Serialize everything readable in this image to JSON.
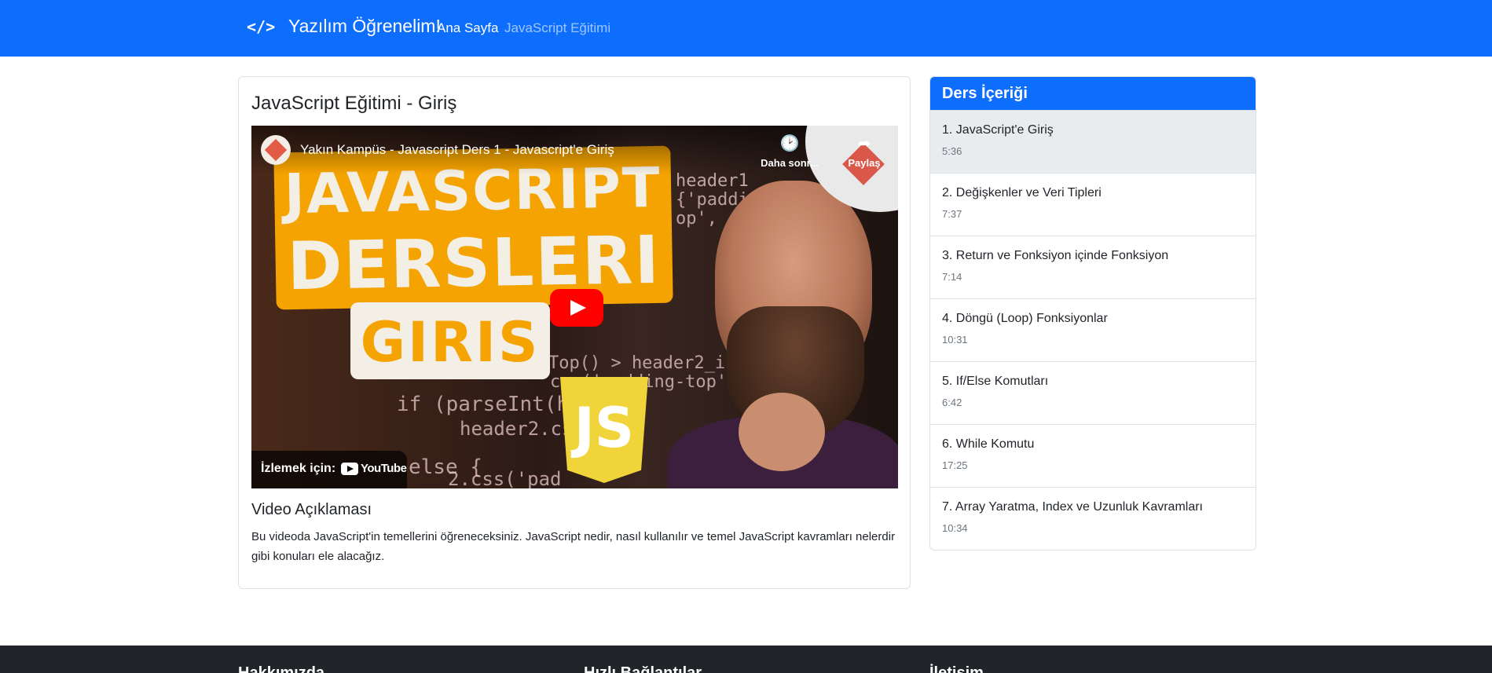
{
  "nav": {
    "brand_icon": "</>",
    "brand": "Yazılım Öğrenelim!",
    "links": [
      "Ana Sayfa",
      "JavaScript Eğitimi"
    ]
  },
  "main": {
    "title": "JavaScript Eğitimi - Giriş",
    "video": {
      "title": "Yakın Kampüs - Javascript Ders 1 - Javascript'e Giriş",
      "watch_later": "Daha sonr...",
      "share": "Paylaş",
      "watch_on": "İzlemek için:",
      "youtube": "YouTube",
      "thumb": {
        "line1": "JAVASCRIPT",
        "line2": "DERSLERI",
        "line3": "GIRIS",
        "js": "JS",
        "code": [
          "header1",
          "{'paddi",
          "op',",
          "rollTop() > header2_initia",
          "css('padding-top'",
          "if (parseInt(h",
          "header2.css",
          "else {",
          "2.css('pad"
        ]
      }
    },
    "description_title": "Video Açıklaması",
    "description": "Bu videoda JavaScript'in temellerini öğreneceksiniz. JavaScript nedir, nasıl kullanılır ve temel JavaScript kavramları nelerdir gibi konuları ele alacağız."
  },
  "sidebar": {
    "title": "Ders İçeriği",
    "lessons": [
      {
        "title": "1. JavaScript'e Giriş",
        "duration": "5:36",
        "active": true
      },
      {
        "title": "2. Değişkenler ve Veri Tipleri",
        "duration": "7:37"
      },
      {
        "title": "3. Return ve Fonksiyon içinde Fonksiyon",
        "duration": "7:14"
      },
      {
        "title": "4. Döngü (Loop) Fonksiyonlar",
        "duration": "10:31"
      },
      {
        "title": "5. If/Else Komutları",
        "duration": "6:42"
      },
      {
        "title": "6. While Komutu",
        "duration": "17:25"
      },
      {
        "title": "7. Array Yaratma, Index ve Uzunluk Kavramları",
        "duration": "10:34"
      }
    ]
  },
  "footer": {
    "headings": [
      "Hakkımızda",
      "Hızlı Bağlantılar",
      "İletişim"
    ]
  },
  "colors": {
    "primary": "#0d6efd",
    "footer": "#212529",
    "active_item": "#e9ecef"
  }
}
